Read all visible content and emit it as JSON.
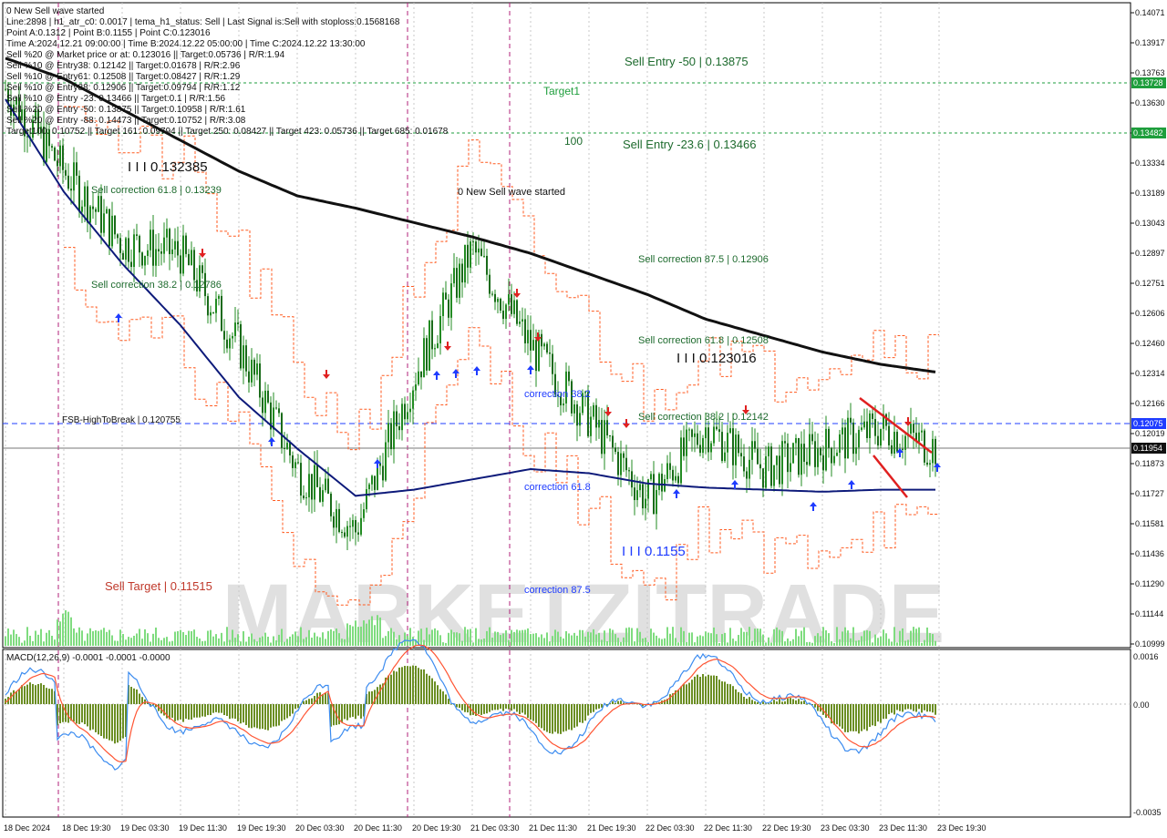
{
  "header": {
    "symbol_line": "0 New Sell wave started",
    "line2": "Line:2898 | h1_atr_c0: 0.0017 | tema_h1_status: Sell | Last Signal is:Sell with stoploss:0.1568168",
    "line3": "Point A:0.1312 | Point B:0.1155 | Point C:0.123016",
    "line4": "Time A:2024.12.21 09:00:00 | Time B:2024.12.22 05:00:00 | Time C:2024.12.22 13:30:00",
    "line5": "Sell %20 @ Market price or at: 0.123016 || Target:0.05736 | R/R:1.94",
    "line6": "Sell %10 @ Entry38: 0.12142 || Target:0.01678 | R/R:2.96",
    "line7": "Sell %10 @ Entry61: 0.12508 || Target:0.08427 | R/R:1.29",
    "line8": "Sell %10 @ Entry88: 0.12906 || Target:0.09794 | R/R:1.12",
    "line9": "Sell %10 @ Entry -23: 0.13466 || Target:0.1 | R/R:1.56",
    "line10": "Sell %20 @ Entry -50: 0.13875 || Target:0.10958 | R/R:1.61",
    "line11": "Sell %20 @ Entry -88: 0.14473 || Target:0.10752 | R/R:3.08",
    "line12": "Target100: 0.10752 || Target 161: 0.09794 || Target 250: 0.08427 || Target 423: 0.05736 || Target 685: 0.01678"
  },
  "annotations": {
    "sell_entry_50": "Sell Entry -50 | 0.13875",
    "target1": "Target1",
    "label_100": "100",
    "sell_entry_236": "Sell Entry -23.6 | 0.13466",
    "point_a": "I I I 0.132385",
    "sell_corr_618_left": "Sell correction 61.8 | 0.13239",
    "new_sell_wave": "0 New Sell wave started",
    "sell_corr_875": "Sell correction 87.5 | 0.12906",
    "sell_corr_382_left": "Sell correction 38.2 | 0.12786",
    "sell_corr_618_right": "Sell correction 61.8 | 0.12508",
    "point_c": "I I I 0.123016",
    "correction_382": "correction 38.2",
    "fsb": "FSB-HighToBreak | 0.120755",
    "sell_corr_382_right": "Sell correction 38.2 | 0.12142",
    "correction_618": "correction 61.8",
    "point_b": "I I I 0.1155",
    "correction_875": "correction 87.5",
    "sell_target": "Sell Target | 0.11515",
    "watermark": "MARKETZITRADE"
  },
  "price_axis": {
    "ticks": [
      "0.14071",
      "0.13917",
      "0.13763",
      "0.13630",
      "0.13480",
      "0.13334",
      "0.13189",
      "0.13043",
      "0.12897",
      "0.12751",
      "0.12606",
      "0.12460",
      "0.12314",
      "0.12166",
      "0.12019",
      "0.11873",
      "0.11727",
      "0.11581",
      "0.11436",
      "0.11290",
      "0.11144",
      "0.10999"
    ],
    "tags": {
      "target1": "0.13728",
      "entry": "0.13482",
      "fsb": "0.12075",
      "last": "0.11954"
    }
  },
  "macd": {
    "label": "MACD(12,26,9) -0.0001 -0.0001 -0.0000",
    "ticks": [
      "0.0016",
      "0.00",
      "-0.0035"
    ]
  },
  "time_axis": {
    "labels": [
      "18 Dec 2024",
      "18 Dec 19:30",
      "19 Dec 03:30",
      "19 Dec 11:30",
      "19 Dec 19:30",
      "20 Dec 03:30",
      "20 Dec 11:30",
      "20 Dec 19:30",
      "21 Dec 03:30",
      "21 Dec 11:30",
      "21 Dec 19:30",
      "22 Dec 03:30",
      "22 Dec 11:30",
      "22 Dec 19:30",
      "23 Dec 03:30",
      "23 Dec 11:30",
      "23 Dec 19:30"
    ]
  },
  "colors": {
    "candles": "#228B22",
    "ema_black": "#111111",
    "ema_navy": "#0d1a7a",
    "band_orange": "#ff5a1f",
    "macd_hist": "#6b8e23",
    "macd_blue": "#3c8cf0",
    "macd_red": "#ff5533",
    "magenta": "#b0207a",
    "blue_tag": "#1f3cff",
    "green_tag": "#1e9e3c",
    "black_tag": "#111111"
  },
  "chart_data": {
    "type": "line",
    "title": "",
    "xlabel": "",
    "ylabel": "",
    "ylim": [
      0.10999,
      0.14071
    ],
    "x": [
      "18 Dec 2024",
      "18 Dec 19:30",
      "19 Dec 03:30",
      "19 Dec 11:30",
      "19 Dec 19:30",
      "20 Dec 03:30",
      "20 Dec 11:30",
      "20 Dec 19:30",
      "21 Dec 03:30",
      "21 Dec 11:30",
      "21 Dec 19:30",
      "22 Dec 03:30",
      "22 Dec 11:30",
      "22 Dec 19:30",
      "23 Dec 03:30",
      "23 Dec 11:30",
      "23 Dec 19:30"
    ],
    "series": [
      {
        "values": [
          0.137,
          0.133,
          0.1295,
          0.129,
          0.1245,
          0.1185,
          0.1155,
          0.123,
          0.1292,
          0.1245,
          0.121,
          0.117,
          0.1205,
          0.1185,
          0.1195,
          0.1205,
          0.1195
        ]
      },
      {
        "values": [
          0.1385,
          0.1375,
          0.136,
          0.1345,
          0.133,
          0.1318,
          0.1312,
          0.1305,
          0.1298,
          0.129,
          0.128,
          0.127,
          0.1258,
          0.125,
          0.1242,
          0.1236,
          0.1232
        ]
      },
      {
        "values": [
          0.1365,
          0.132,
          0.1285,
          0.1255,
          0.122,
          0.1195,
          0.1172,
          0.1175,
          0.118,
          0.1185,
          0.1183,
          0.1178,
          0.1176,
          0.1175,
          0.1174,
          0.1175,
          0.1175
        ]
      }
    ],
    "levels": [
      {
        "label": "Target1",
        "value": 0.13728
      },
      {
        "label": "Sell Entry -23.6",
        "value": 0.13482
      },
      {
        "label": "FSB-HighToBreak",
        "value": 0.12075
      },
      {
        "label": "last",
        "value": 0.11954
      }
    ]
  }
}
